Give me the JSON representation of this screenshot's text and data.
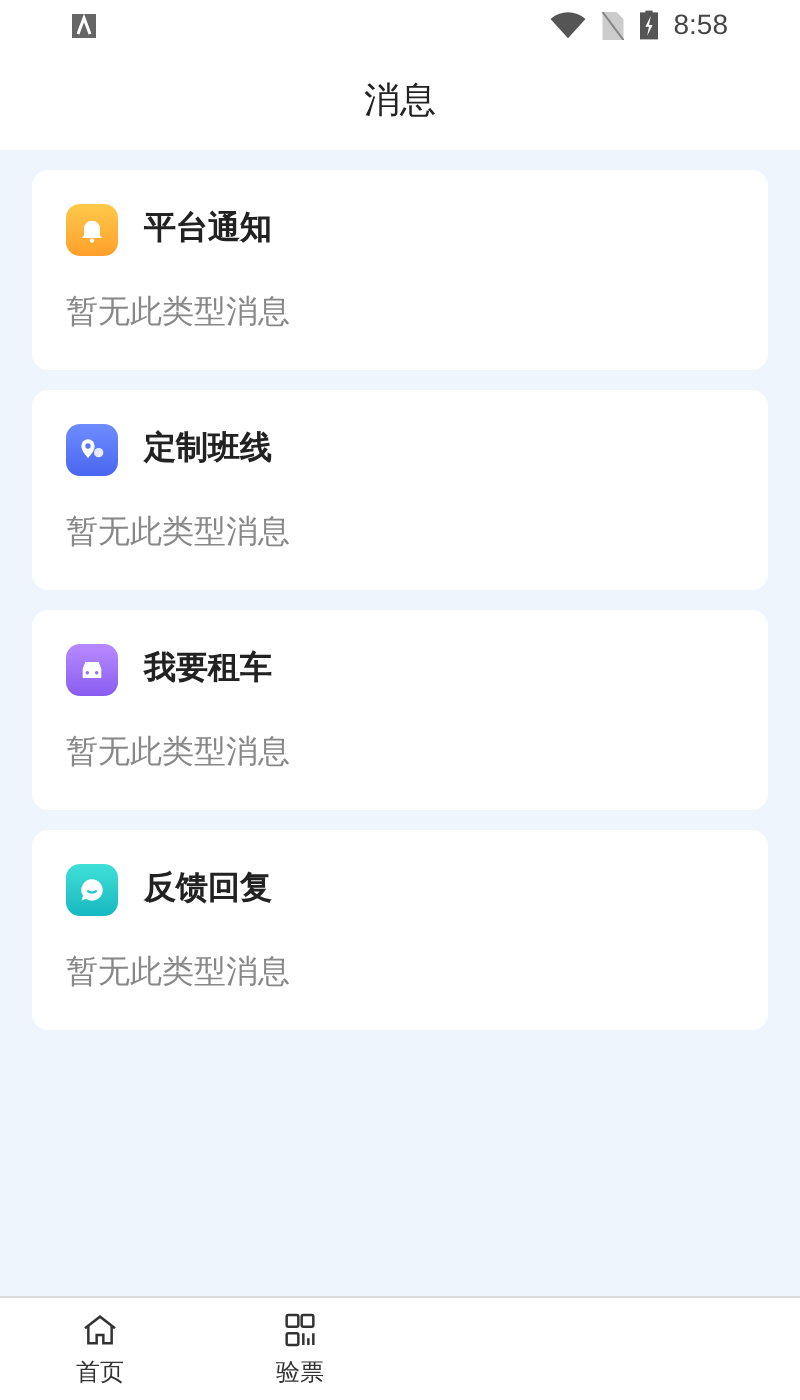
{
  "status_bar": {
    "time": "8:58"
  },
  "header": {
    "title": "消息"
  },
  "categories": [
    {
      "kind": "notice",
      "title": "平台通知",
      "message": "暂无此类型消息"
    },
    {
      "kind": "route",
      "title": "定制班线",
      "message": "暂无此类型消息"
    },
    {
      "kind": "rental",
      "title": "我要租车",
      "message": "暂无此类型消息"
    },
    {
      "kind": "feedback",
      "title": "反馈回复",
      "message": "暂无此类型消息"
    }
  ],
  "tab_bar": [
    {
      "kind": "home",
      "label": "首页",
      "selected": false
    },
    {
      "kind": "ticket",
      "label": "验票",
      "selected": false
    }
  ]
}
